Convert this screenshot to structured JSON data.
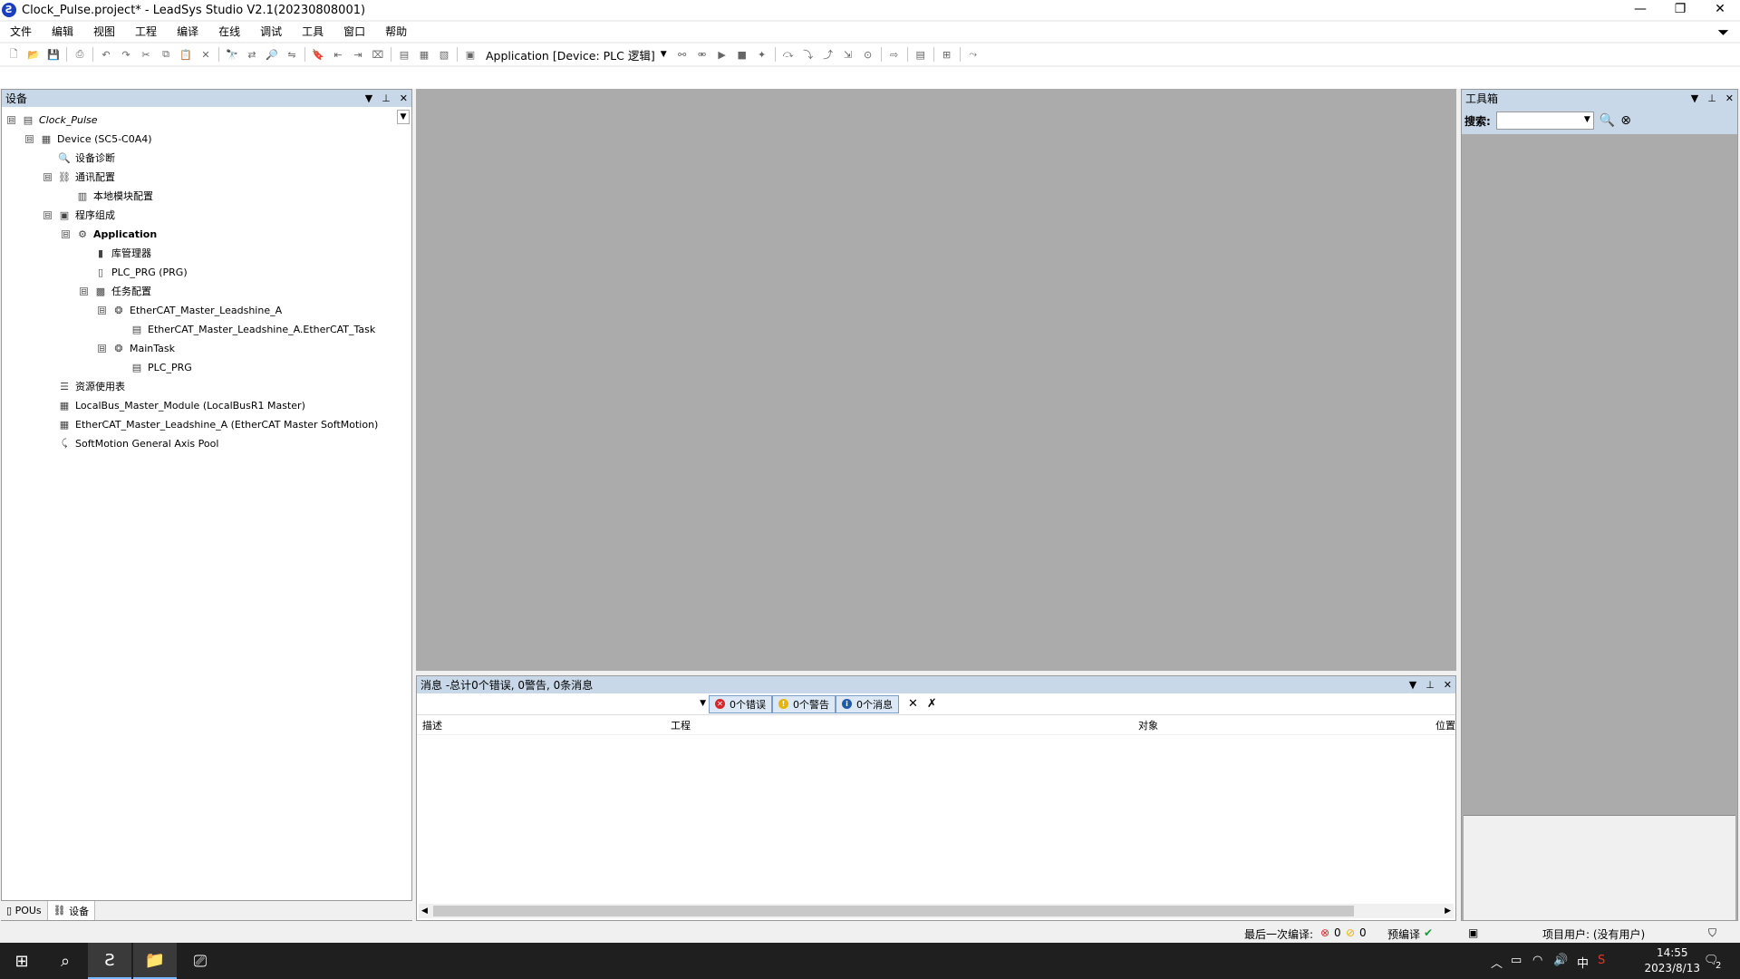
{
  "window": {
    "title": "Clock_Pulse.project* - LeadSys Studio V2.1(20230808001)",
    "minimize": "—",
    "restore": "❐",
    "close": "✕"
  },
  "menu": {
    "items": [
      "文件",
      "编辑",
      "视图",
      "工程",
      "编译",
      "在线",
      "调试",
      "工具",
      "窗口",
      "帮助"
    ]
  },
  "toolbar": {
    "application_label": "Application [Device: PLC 逻辑]"
  },
  "devices_panel": {
    "title": "设备",
    "tree": [
      {
        "label": "Clock_Pulse",
        "level": 0,
        "expander": "⊟",
        "icon": "project-icon",
        "glyph": "▤",
        "style": "italic"
      },
      {
        "label": "Device (SC5-C0A4)",
        "level": 1,
        "expander": "⊟",
        "icon": "device-icon",
        "glyph": "▦",
        "style": ""
      },
      {
        "label": "设备诊断",
        "level": 2,
        "expander": "",
        "icon": "diagnose-icon",
        "glyph": "🔍",
        "style": ""
      },
      {
        "label": "通讯配置",
        "level": 2,
        "expander": "⊟",
        "icon": "network-icon",
        "glyph": "⛓",
        "style": ""
      },
      {
        "label": "本地模块配置",
        "level": 3,
        "expander": "",
        "icon": "module-icon",
        "glyph": "▥",
        "style": ""
      },
      {
        "label": "程序组成",
        "level": 2,
        "expander": "⊟",
        "icon": "program-icon",
        "glyph": "▣",
        "style": ""
      },
      {
        "label": "Application",
        "level": 3,
        "expander": "⊟",
        "icon": "application-icon",
        "glyph": "⚙",
        "style": "bold"
      },
      {
        "label": "库管理器",
        "level": 4,
        "expander": "",
        "icon": "library-icon",
        "glyph": "▮",
        "style": ""
      },
      {
        "label": "PLC_PRG (PRG)",
        "level": 4,
        "expander": "",
        "icon": "pou-icon",
        "glyph": "▯",
        "style": ""
      },
      {
        "label": "任务配置",
        "level": 4,
        "expander": "⊟",
        "icon": "task-config-icon",
        "glyph": "▩",
        "style": ""
      },
      {
        "label": "EtherCAT_Master_Leadshine_A",
        "level": 5,
        "expander": "⊟",
        "icon": "task-icon",
        "glyph": "❂",
        "style": ""
      },
      {
        "label": "EtherCAT_Master_Leadshine_A.EtherCAT_Task",
        "level": 6,
        "expander": "",
        "icon": "task-call-icon",
        "glyph": "▤",
        "style": ""
      },
      {
        "label": "MainTask",
        "level": 5,
        "expander": "⊟",
        "icon": "task-icon",
        "glyph": "❂",
        "style": ""
      },
      {
        "label": "PLC_PRG",
        "level": 6,
        "expander": "",
        "icon": "task-call-icon",
        "glyph": "▤",
        "style": ""
      },
      {
        "label": "资源使用表",
        "level": 2,
        "expander": "",
        "icon": "resource-icon",
        "glyph": "☰",
        "style": ""
      },
      {
        "label": "LocalBus_Master_Module (LocalBusR1 Master)",
        "level": 2,
        "expander": "",
        "icon": "bus-module-icon",
        "glyph": "▦",
        "style": ""
      },
      {
        "label": "EtherCAT_Master_Leadshine_A (EtherCAT Master SoftMotion)",
        "level": 2,
        "expander": "",
        "icon": "ethercat-master-icon",
        "glyph": "▦",
        "style": ""
      },
      {
        "label": "SoftMotion General Axis Pool",
        "level": 2,
        "expander": "",
        "icon": "axis-pool-icon",
        "glyph": "⤹",
        "style": ""
      }
    ],
    "bottom_tabs": [
      {
        "label": "POUs",
        "icon": "pous-icon"
      },
      {
        "label": "设备",
        "icon": "devices-icon"
      }
    ]
  },
  "messages_panel": {
    "title": "消息 -总计0个错误, 0警告, 0条消息",
    "errors": "0个错误",
    "warnings": "0个警告",
    "infos": "0个消息",
    "columns": [
      "描述",
      "工程",
      "对象",
      "位置"
    ]
  },
  "toolbox_panel": {
    "title": "工具箱",
    "search_label": "搜索:"
  },
  "statusbar": {
    "last_compile": "最后一次编译:",
    "errors_count": "0",
    "warnings_count": "0",
    "precompile": "预编译",
    "project_user": "项目用户: (没有用户)"
  },
  "taskbar": {
    "ime": "中",
    "time": "14:55",
    "date": "2023/8/13",
    "notifications": "2"
  },
  "colors": {
    "panel_header": "#c8d8e8",
    "editor_bg": "#ababab",
    "error": "#d9262c",
    "warning": "#e8b400",
    "info": "#1e5aa8"
  }
}
